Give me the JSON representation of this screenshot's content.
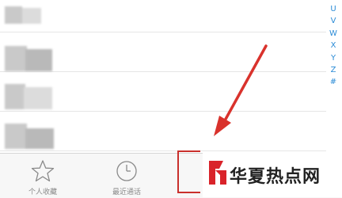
{
  "index_bar": {
    "letters": [
      "U",
      "V",
      "W",
      "X",
      "Y",
      "Z",
      "#"
    ]
  },
  "tab_bar": {
    "tabs": [
      {
        "label": "个人收藏",
        "icon": "star-icon"
      },
      {
        "label": "最近通话",
        "icon": "clock-icon"
      }
    ]
  },
  "watermark": {
    "text": "华夏热点网"
  },
  "colors": {
    "index_letters": "#2a8bd6",
    "annotation_arrow": "#d9322c",
    "tab_bar_bg": "#f7f7f7"
  }
}
